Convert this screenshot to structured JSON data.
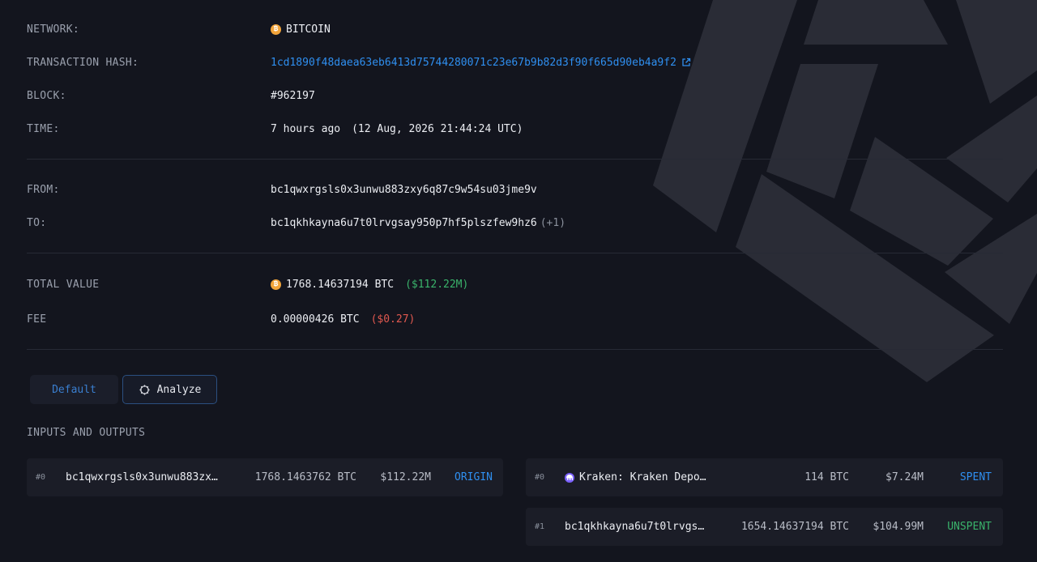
{
  "fields": {
    "network": {
      "label": "NETWORK:",
      "value": "BITCOIN"
    },
    "hash": {
      "label": "TRANSACTION HASH:",
      "value": "1cd1890f48daea63eb6413d75744280071c23e67b9b82d3f90f665d90eb4a9f2"
    },
    "block": {
      "label": "BLOCK:",
      "value": "#962197"
    },
    "time": {
      "label": "TIME:",
      "relative": "7 hours ago",
      "absolute": "(12 Aug, 2026 21:44:24 UTC)"
    },
    "from": {
      "label": "FROM:",
      "value": "bc1qwxrgsls0x3unwu883zxy6q87c9w54su03jme9v"
    },
    "to": {
      "label": "TO:",
      "value": "bc1qkhkayna6u7t0lrvgsay950p7hf5plszfew9hz6",
      "extra": "(+1)"
    },
    "total_value": {
      "label": "TOTAL VALUE",
      "value": "1768.14637194 BTC",
      "usd": "($112.22M)"
    },
    "fee": {
      "label": "FEE",
      "value": "0.00000426 BTC",
      "usd": "($0.27)"
    }
  },
  "tabs": {
    "default_label": "Default",
    "analyze_label": "Analyze"
  },
  "io": {
    "title": "INPUTS AND OUTPUTS",
    "inputs": [
      {
        "index": "#0",
        "address": "bc1qwxrgsls0x3unwu883zx…",
        "amount": "1768.1463762 BTC",
        "usd": "$112.22M",
        "status": "ORIGIN"
      }
    ],
    "outputs": [
      {
        "index": "#0",
        "address": "Kraken: Kraken Depo…",
        "amount": "114 BTC",
        "usd": "$7.24M",
        "status": "SPENT"
      },
      {
        "index": "#1",
        "address": "bc1qkhkayna6u7t0lrvgs…",
        "amount": "1654.14637194 BTC",
        "usd": "$104.99M",
        "status": "UNSPENT"
      }
    ]
  },
  "colors": {
    "background": "#13151e",
    "link": "#2f8ff0",
    "positive": "#3ab36b",
    "negative": "#e0584f",
    "bitcoin": "#f2a43a",
    "kraken": "#7b61ff"
  },
  "icons": {
    "network": "bitcoin-icon",
    "hash_link": "external-link-icon",
    "analyze": "spiral-icon",
    "kraken": "kraken-icon"
  }
}
